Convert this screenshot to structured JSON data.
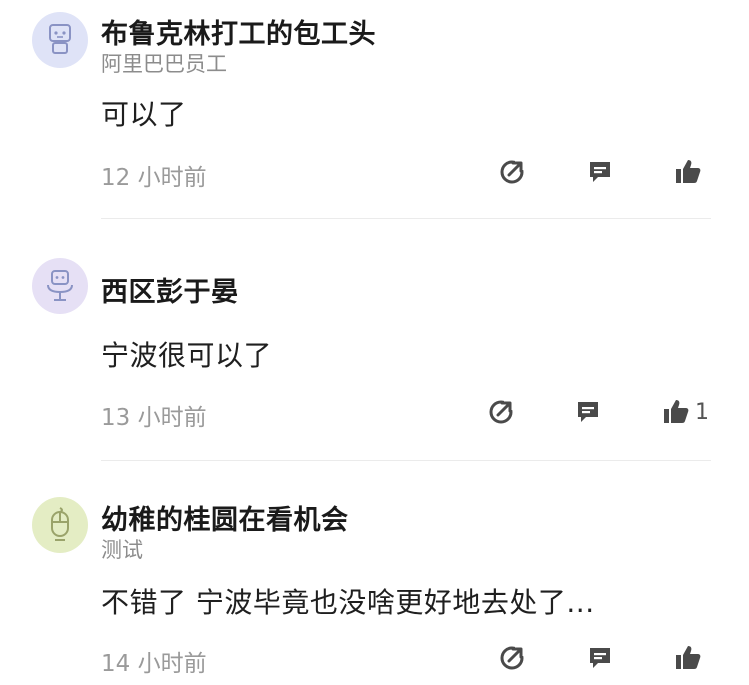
{
  "comments": [
    {
      "username": "布鲁克林打工的包工头",
      "subtitle": "阿里巴巴员工",
      "content": "可以了",
      "time": "12 小时前",
      "likes": "",
      "avatar_icon": "robot-icon",
      "avatar_bg": "#dfe3f7"
    },
    {
      "username": "西区彭于晏",
      "subtitle": "",
      "content": "宁波很可以了",
      "time": "13 小时前",
      "likes": "1",
      "avatar_icon": "robot-chair-icon",
      "avatar_bg": "#e6e0f5"
    },
    {
      "username": "幼稚的桂圆在看机会",
      "subtitle": "测试",
      "content": "不错了 宁波毕竟也没啥更好地去处了...",
      "time": "14 小时前",
      "likes": "",
      "avatar_icon": "mouse-icon",
      "avatar_bg": "#e4edc4"
    }
  ],
  "icons": {
    "share": "share-icon",
    "reply": "comment-icon",
    "like": "thumbs-up-icon"
  },
  "colors": {
    "icon": "#4a4a4a",
    "avatar_stroke": "#8a93c4"
  }
}
